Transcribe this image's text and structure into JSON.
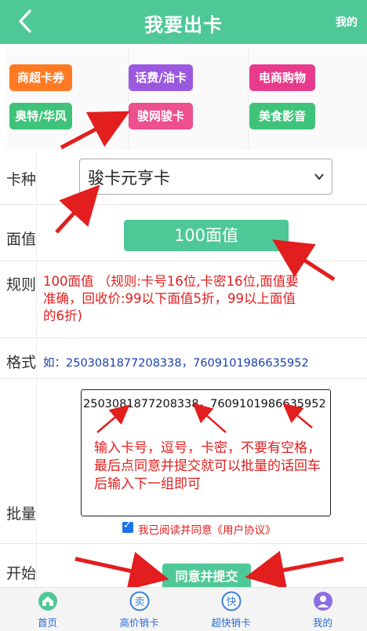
{
  "header": {
    "title": "我要出卡",
    "right_link": "我的",
    "back_icon": "chevron-left-icon",
    "background": "#4fc897"
  },
  "categories": [
    {
      "label": "商超卡券",
      "color": "#ff7a22"
    },
    {
      "label": "话费/油卡",
      "color": "#9b59e0"
    },
    {
      "label": "电商购物",
      "color": "#e93b8c"
    },
    {
      "label": "奥特/华风",
      "color": "#3fc37a"
    },
    {
      "label": "骏网骏卡",
      "color": "#ee4f8f"
    },
    {
      "label": "美食影音",
      "color": "#3fc37a"
    }
  ],
  "form": {
    "card_type_label": "卡种",
    "card_type_value": "骏卡元亨卡",
    "denomination_label": "面值",
    "denomination_value": "100面值",
    "rule_label": "规则",
    "rule_text": "100面值 （规则:卡号16位,卡密16位,面值要准确，回收价:99以下面值5折，99以上面值的6折)",
    "format_label": "格式",
    "format_text": "如：2503081877208338，7609101986635952",
    "batch_label": "批量",
    "batch_value": "2503081877208338，7609101986635952",
    "batch_hint": "输入卡号，逗号，卡密，不要有空格，最后点同意并提交就可以批量的话回车后输入下一组即可",
    "agree_text": "我已阅读并同意《用户协议》",
    "agree_checked": true,
    "start_label": "开始",
    "submit_label": "同意并提交"
  },
  "tabbar": [
    {
      "label": "首页",
      "icon": "home-icon",
      "icon_color": "#4fc897"
    },
    {
      "label": "高价销卡",
      "icon": "sell-badge-icon",
      "icon_color": "#3b82d6",
      "glyph": "卖"
    },
    {
      "label": "超快销卡",
      "icon": "fast-badge-icon",
      "icon_color": "#3b82d6",
      "glyph": "快"
    },
    {
      "label": "我的",
      "icon": "user-icon",
      "icon_color": "#8e6fe0"
    }
  ],
  "colors": {
    "accent": "#4fc897",
    "annotation_red": "#e21e1e",
    "format_blue": "#1a3fae",
    "tab_label_blue": "#2a6ad3"
  }
}
